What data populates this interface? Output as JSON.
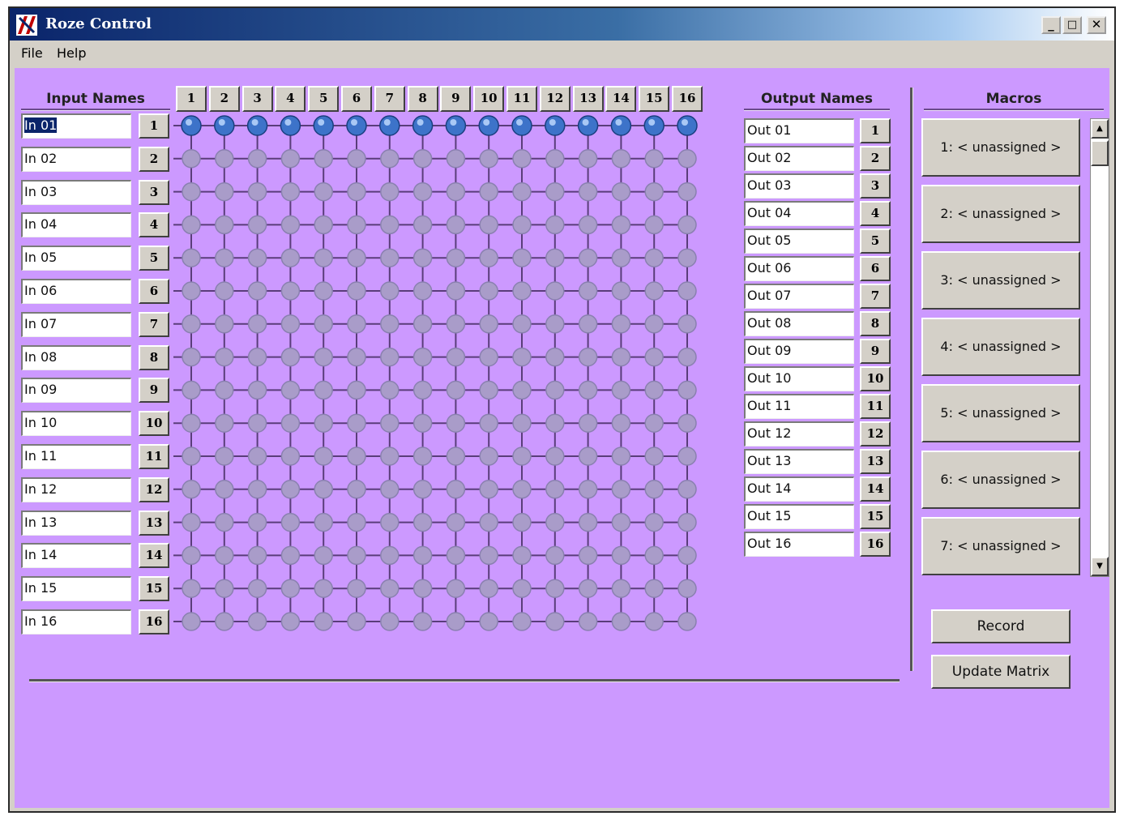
{
  "window": {
    "title": "Roze Control",
    "min_label": "_",
    "max_label": "□",
    "close_label": "✕"
  },
  "menu": {
    "file": "File",
    "help": "Help"
  },
  "inputs": {
    "header": "Input Names",
    "names": [
      "In 01",
      "In 02",
      "In 03",
      "In 04",
      "In 05",
      "In 06",
      "In 07",
      "In 08",
      "In 09",
      "In 10",
      "In 11",
      "In 12",
      "In 13",
      "In 14",
      "In 15",
      "In 16"
    ],
    "numbers": [
      "1",
      "2",
      "3",
      "4",
      "5",
      "6",
      "7",
      "8",
      "9",
      "10",
      "11",
      "12",
      "13",
      "14",
      "15",
      "16"
    ]
  },
  "outputs": {
    "header": "Output Names",
    "names": [
      "Out 01",
      "Out 02",
      "Out 03",
      "Out 04",
      "Out 05",
      "Out 06",
      "Out 07",
      "Out 08",
      "Out 09",
      "Out 10",
      "Out 11",
      "Out 12",
      "Out 13",
      "Out 14",
      "Out 15",
      "Out 16"
    ],
    "numbers": [
      "1",
      "2",
      "3",
      "4",
      "5",
      "6",
      "7",
      "8",
      "9",
      "10",
      "11",
      "12",
      "13",
      "14",
      "15",
      "16"
    ]
  },
  "matrix": {
    "column_labels": [
      "1",
      "2",
      "3",
      "4",
      "5",
      "6",
      "7",
      "8",
      "9",
      "10",
      "11",
      "12",
      "13",
      "14",
      "15",
      "16"
    ],
    "active_input_row": 1,
    "colors": {
      "active": "#3d73c9",
      "inactive": "#a99cc9",
      "line": "#5a3d7a"
    }
  },
  "macros": {
    "header": "Macros",
    "items": [
      "1: < unassigned >",
      "2: < unassigned >",
      "3: < unassigned >",
      "4: < unassigned >",
      "5: < unassigned >",
      "6: < unassigned >",
      "7: < unassigned >"
    ]
  },
  "buttons": {
    "record": "Record",
    "update_matrix": "Update Matrix"
  },
  "colors": {
    "client_bg": "#cc99ff",
    "chrome": "#d4d0c8",
    "title_dark": "#0a246a"
  }
}
